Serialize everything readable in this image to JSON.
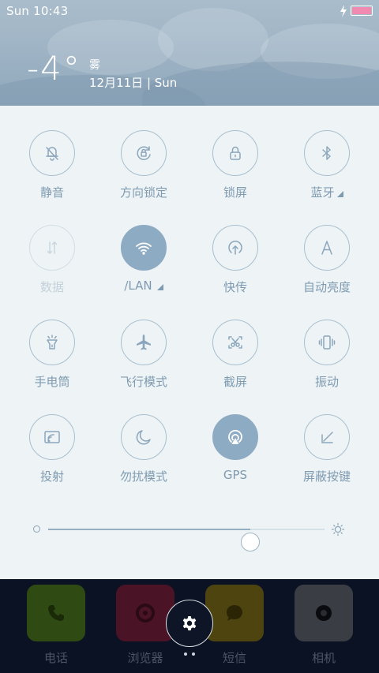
{
  "statusbar": {
    "time": "Sun  10:43"
  },
  "weather": {
    "temp": "-4°",
    "condition": "雾",
    "date": "12月11日 | Sun"
  },
  "tiles": [
    {
      "label": "静音",
      "icon": "bell-off-icon",
      "state": "off"
    },
    {
      "label": "方向锁定",
      "icon": "rotation-lock-icon",
      "state": "off"
    },
    {
      "label": "锁屏",
      "icon": "lock-icon",
      "state": "off"
    },
    {
      "label": "蓝牙",
      "icon": "bluetooth-icon",
      "state": "off",
      "has_more": true
    },
    {
      "label": "数据",
      "icon": "data-arrows-icon",
      "state": "disabled"
    },
    {
      "label": "/LAN",
      "icon": "wifi-icon",
      "state": "on",
      "has_more": true
    },
    {
      "label": "快传",
      "icon": "upload-icon",
      "state": "off"
    },
    {
      "label": "自动亮度",
      "icon": "auto-brightness-icon",
      "state": "off"
    },
    {
      "label": "手电筒",
      "icon": "flashlight-icon",
      "state": "off"
    },
    {
      "label": "飞行模式",
      "icon": "airplane-icon",
      "state": "off"
    },
    {
      "label": "截屏",
      "icon": "screenshot-icon",
      "state": "off"
    },
    {
      "label": "振动",
      "icon": "vibrate-icon",
      "state": "off"
    },
    {
      "label": "投射",
      "icon": "cast-icon",
      "state": "off"
    },
    {
      "label": "勿扰模式",
      "icon": "moon-icon",
      "state": "off"
    },
    {
      "label": "GPS",
      "icon": "gps-icon",
      "state": "on"
    },
    {
      "label": "屏蔽按键",
      "icon": "key-block-icon",
      "state": "off"
    }
  ],
  "brightness": {
    "level_percent": 73
  },
  "dock": {
    "apps": [
      {
        "label": "电话",
        "icon": "phone-icon",
        "color": "#2f4a12"
      },
      {
        "label": "浏览器",
        "icon": "browser-icon",
        "color": "#4a1426"
      },
      {
        "label": "短信",
        "icon": "message-icon",
        "color": "#4e4410"
      },
      {
        "label": "相机",
        "icon": "camera-icon",
        "color": "#3b3d44"
      }
    ]
  }
}
